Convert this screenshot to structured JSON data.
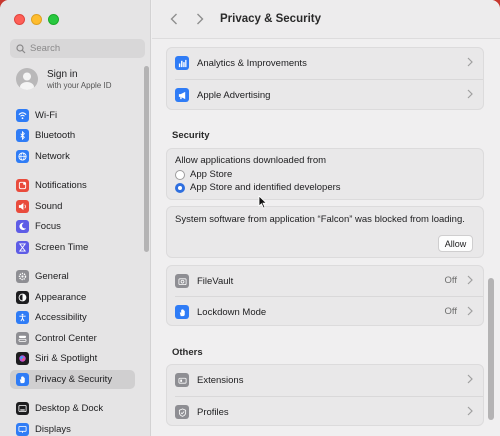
{
  "search": {
    "placeholder": "Search"
  },
  "account": {
    "title": "Sign in",
    "subtitle": "with your Apple ID"
  },
  "sidebar": {
    "items": [
      {
        "label": "Wi-Fi",
        "icon": "wifi-icon",
        "color": "#2f7cf6"
      },
      {
        "label": "Bluetooth",
        "icon": "bluetooth-icon",
        "color": "#2f7cf6"
      },
      {
        "label": "Network",
        "icon": "globe-icon",
        "color": "#2f7cf6"
      },
      {
        "label": "Notifications",
        "icon": "bell-icon",
        "color": "#e94b3c"
      },
      {
        "label": "Sound",
        "icon": "speaker-icon",
        "color": "#e94b3c"
      },
      {
        "label": "Focus",
        "icon": "moon-icon",
        "color": "#5e5ce6"
      },
      {
        "label": "Screen Time",
        "icon": "hourglass-icon",
        "color": "#5e5ce6"
      },
      {
        "label": "General",
        "icon": "gear-icon",
        "color": "#8e8e93"
      },
      {
        "label": "Appearance",
        "icon": "appearance-icon",
        "color": "#1d1d1f"
      },
      {
        "label": "Accessibility",
        "icon": "accessibility-icon",
        "color": "#2f7cf6"
      },
      {
        "label": "Control Center",
        "icon": "control-center-icon",
        "color": "#8e8e93"
      },
      {
        "label": "Siri & Spotlight",
        "icon": "siri-icon",
        "color": "#1d1d1f"
      },
      {
        "label": "Privacy & Security",
        "icon": "hand-icon",
        "color": "#2f7cf6"
      },
      {
        "label": "Desktop & Dock",
        "icon": "dock-icon",
        "color": "#1d1d1f"
      },
      {
        "label": "Displays",
        "icon": "display-icon",
        "color": "#2f7cf6"
      }
    ]
  },
  "toolbar": {
    "title": "Privacy & Security"
  },
  "privacy_rows": [
    {
      "label": "Analytics & Improvements",
      "icon": "chart-icon"
    },
    {
      "label": "Apple Advertising",
      "icon": "megaphone-icon"
    }
  ],
  "security": {
    "title": "Security",
    "downloads_label": "Allow applications downloaded from",
    "options": [
      "App Store",
      "App Store and identified developers"
    ],
    "blocked_message": "System software from application “Falcon” was blocked from loading.",
    "allow_label": "Allow"
  },
  "security_rows": [
    {
      "label": "FileVault",
      "value": "Off",
      "icon": "vault-icon"
    },
    {
      "label": "Lockdown Mode",
      "value": "Off",
      "icon": "hand-icon"
    }
  ],
  "others": {
    "title": "Others",
    "rows": [
      {
        "label": "Extensions",
        "icon": "extensions-icon"
      },
      {
        "label": "Profiles",
        "icon": "profiles-icon"
      }
    ]
  }
}
